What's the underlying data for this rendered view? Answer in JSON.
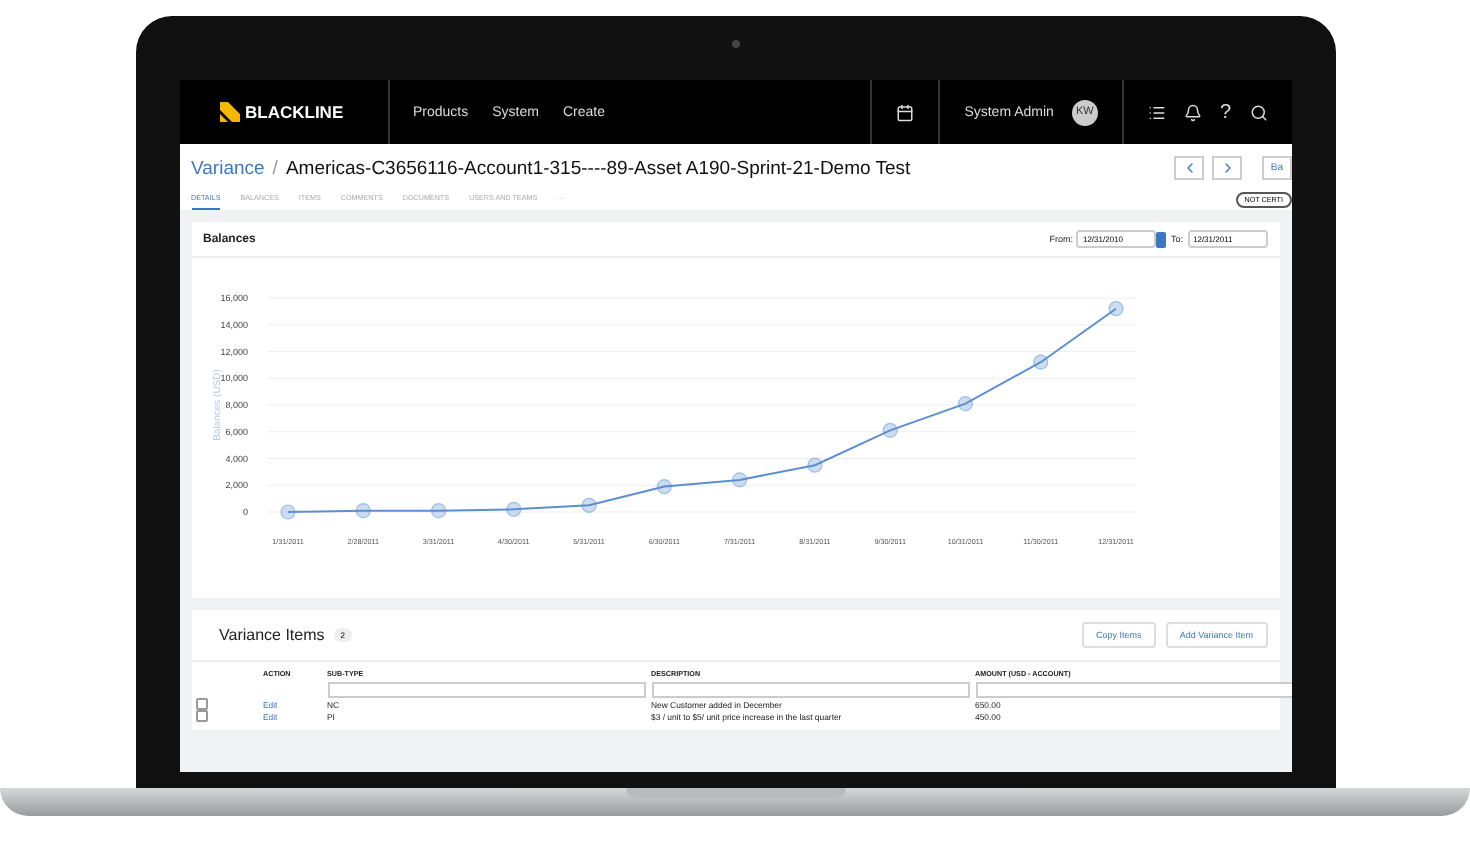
{
  "nav": {
    "logo": "BLACKLINE",
    "menu": [
      "Products",
      "System",
      "Create"
    ],
    "user": "System Admin",
    "initials": "KW",
    "help": "?"
  },
  "header": {
    "breadcrumb": "Variance",
    "separator": "/",
    "title": "Americas-C3656116-Account1-315----89-Asset A190-Sprint-21-Demo Test",
    "button": "Ba",
    "status": "NOT CERTI"
  },
  "tabs": [
    {
      "label": "DETAILS",
      "selected": true
    },
    {
      "label": "BALANCES",
      "selected": false
    },
    {
      "label": "ITEMS",
      "selected": false
    },
    {
      "label": "COMMENTS",
      "selected": false
    },
    {
      "label": "DOCUMENTS",
      "selected": false
    },
    {
      "label": "USERS AND TEAMS",
      "selected": false
    },
    {
      "label": "···",
      "selected": false
    }
  ],
  "balances": {
    "title": "Balances",
    "from_label": "From:",
    "from": "12/31/2010",
    "to_label": "To:",
    "to": "12/31/2011",
    "chart_data": {
      "type": "line",
      "grid": true,
      "ylabel": "Balances (USD)",
      "categories": [
        "1/31/2011",
        "2/28/2011",
        "3/31/2011",
        "4/30/2011",
        "5/31/2011",
        "6/30/2011",
        "7/31/2011",
        "8/31/2011",
        "9/30/2011",
        "10/31/2011",
        "11/30/2011",
        "12/31/2011"
      ],
      "series": [
        {
          "color": "#5b8fd1",
          "marker": "circle",
          "values": [
            0,
            100,
            100,
            200,
            500,
            1900,
            2400,
            3500,
            6100,
            8100,
            11200,
            15200
          ]
        }
      ],
      "ylim": [
        0,
        16000
      ],
      "yticks": [
        {
          "value": 0,
          "label": "0"
        },
        {
          "value": 2000,
          "label": "2,000"
        },
        {
          "value": 4000,
          "label": "4,000"
        },
        {
          "value": 6000,
          "label": "6,000"
        },
        {
          "value": 8000,
          "label": "8,000"
        },
        {
          "value": 10000,
          "label": "10,000"
        },
        {
          "value": 12000,
          "label": "12,000"
        },
        {
          "value": 14000,
          "label": "14,000"
        },
        {
          "value": 16000,
          "label": "16,000"
        }
      ]
    }
  },
  "variance_items": {
    "title": "Variance Items",
    "count": "2",
    "buttons": [
      "Copy Items",
      "Add Variance Item"
    ],
    "columns": [
      "ACTION",
      "SUB-TYPE",
      "DESCRIPTION",
      "AMOUNT (USD - ACCOUNT)"
    ],
    "rows": [
      {
        "checked": false,
        "action": "Edit",
        "sub_type": "NC",
        "description": "New Customer added in December",
        "amount": "650.00"
      },
      {
        "checked": false,
        "action": "Edit",
        "sub_type": "PI",
        "description": "$3 / unit to $5/ unit price increase in the last quarter",
        "amount": "450.00"
      }
    ]
  }
}
